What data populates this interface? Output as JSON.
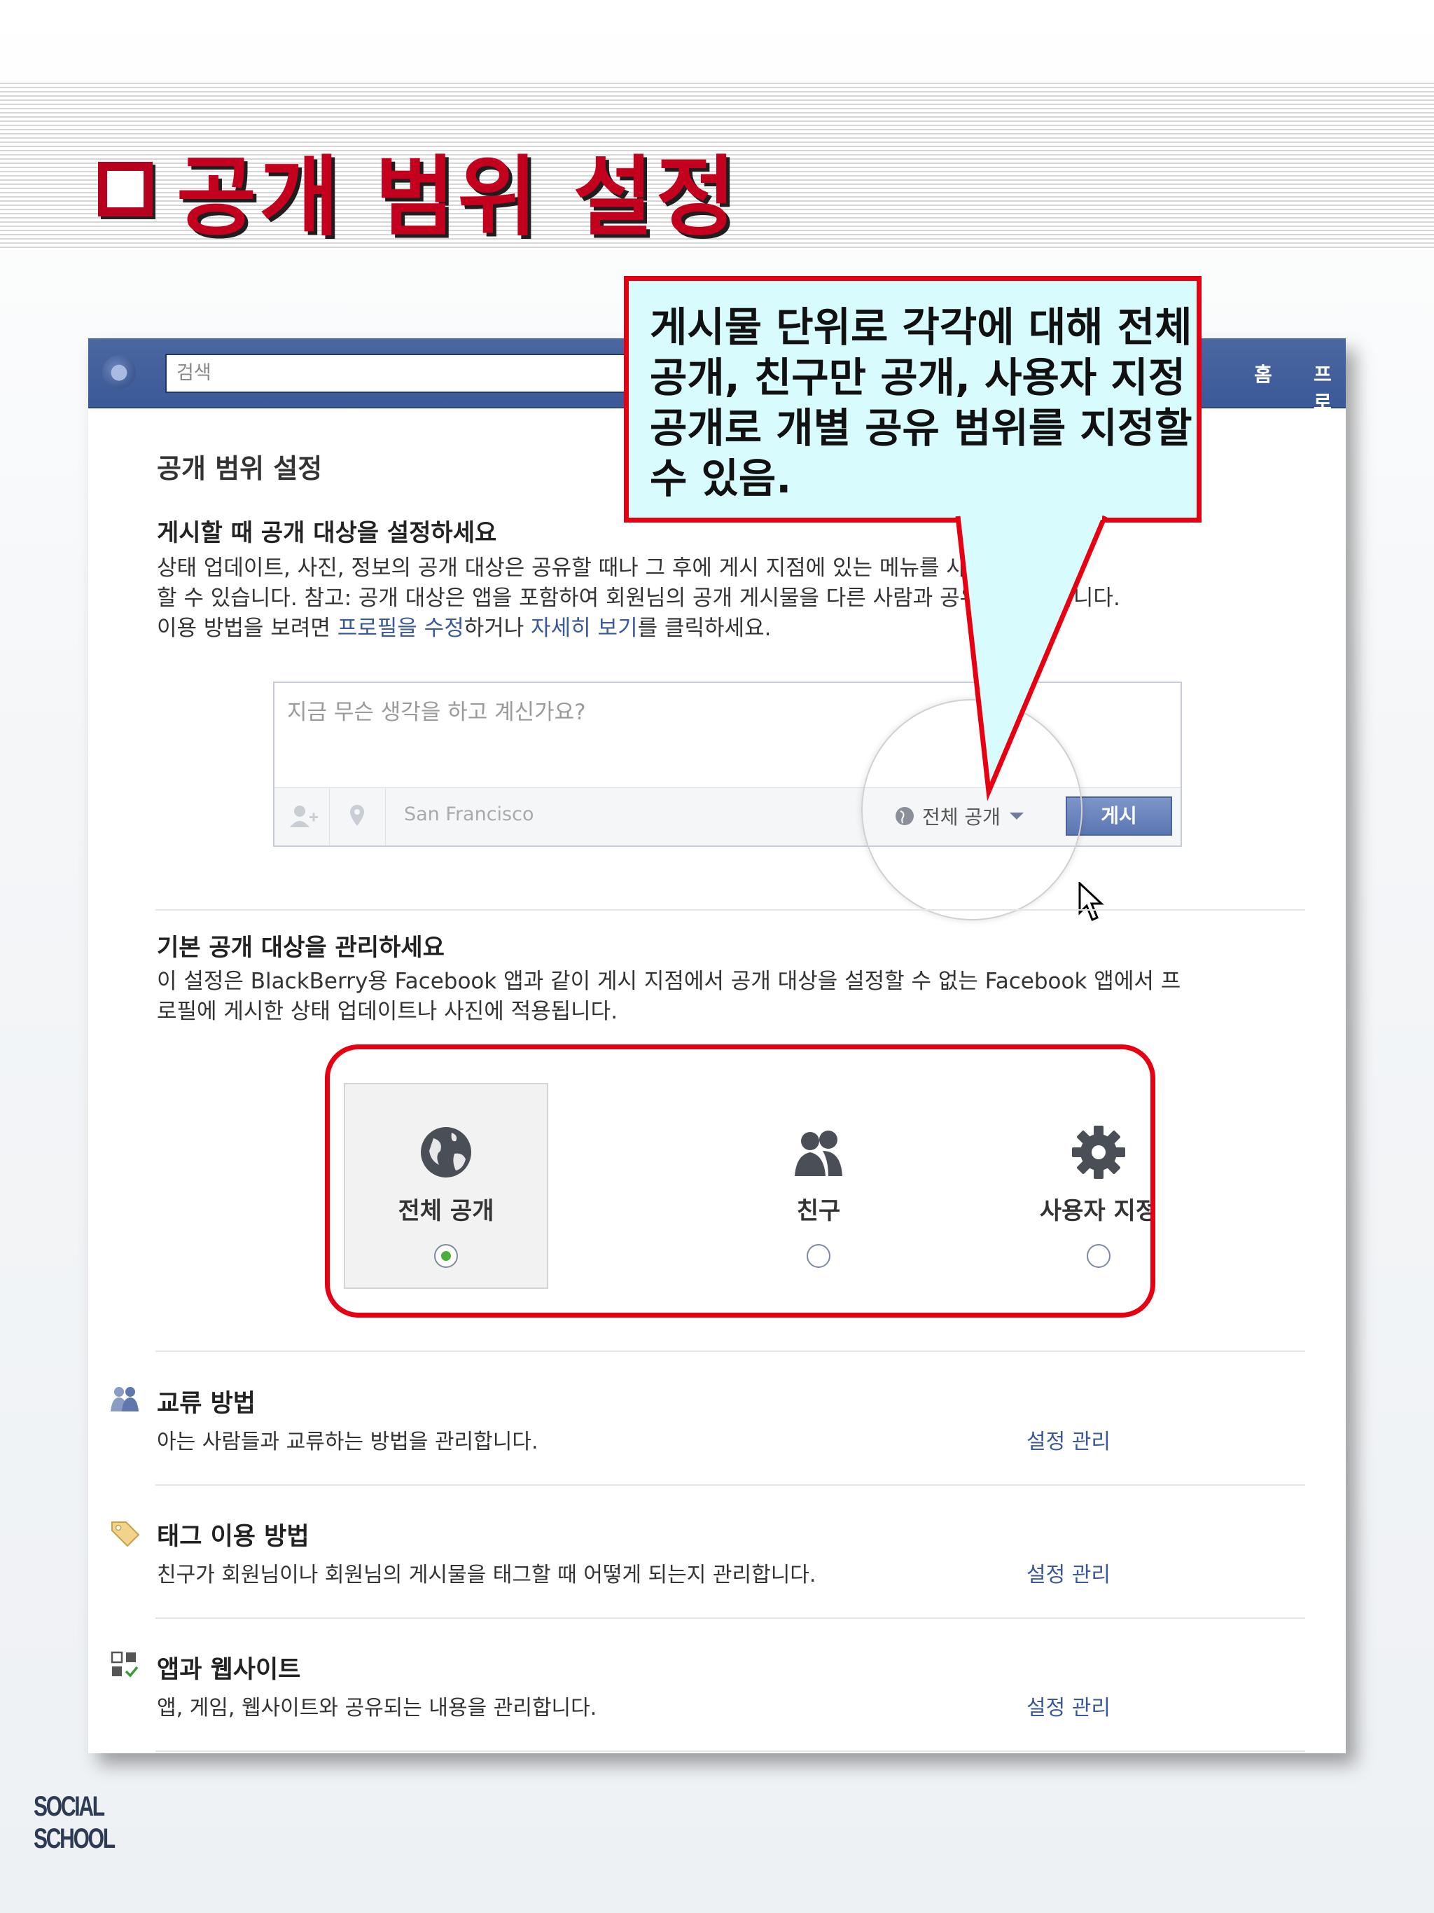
{
  "slide": {
    "title": "공개 범위 설정",
    "logo_text": "SOCIAL SCHOOL"
  },
  "callout": {
    "text": "게시물 단위로 각각에 대해 전체공개, 친구만 공개, 사용자 지정 공개로 개별 공유 범위를 지정할 수 있음."
  },
  "topbar": {
    "search_placeholder": "검색",
    "nav_home": "홈",
    "nav_profile": "프로"
  },
  "page": {
    "heading": "공개 범위 설정",
    "section1": {
      "title": "게시할 때 공개 대상을 설정하세요",
      "desc_line1": "상태 업데이트, 사진, 정보의 공개 대상은 공유할 때나 그 후에 게시 지점에 있는 메뉴를 사용하여 관리",
      "desc_line2": "할 수 있습니다. 참고: 공개 대상은 앱을 포함하여 회원님의 공개 게시물을 다른 사람과 공유할 수 있습니다.",
      "desc_line3_a": "이용 방법을 보려면 ",
      "desc_link1": "프로필을 수정",
      "desc_line3_b": "하거나 ",
      "desc_link2": "자세히 보기",
      "desc_line3_c": "를 클릭하세요."
    },
    "composer": {
      "placeholder": "지금 무슨 생각을 하고 계신가요?",
      "location": "San Francisco",
      "audience": "전체 공개",
      "post_button": "게시"
    },
    "section2": {
      "title": "기본 공개 대상을 관리하세요",
      "desc_line1": "이 설정은 BlackBerry용 Facebook 앱과 같이 게시 지점에서 공개 대상을 설정할 수 없는 Facebook 앱에서 프",
      "desc_line2": "로필에 게시한 상태 업데이트나 사진에 적용됩니다."
    },
    "privacy_options": [
      {
        "label": "전체 공개",
        "icon": "globe-icon",
        "selected": true
      },
      {
        "label": "친구",
        "icon": "friends-icon",
        "selected": false
      },
      {
        "label": "사용자 지정",
        "icon": "gear-icon",
        "selected": false
      }
    ],
    "settings": [
      {
        "title": "교류 방법",
        "desc": "아는 사람들과 교류하는 방법을 관리합니다.",
        "link": "설정 관리",
        "icon": "people-icon"
      },
      {
        "title": "태그 이용 방법",
        "desc": "친구가 회원님이나 회원님의 게시물을 태그할 때 어떻게 되는지 관리합니다.",
        "link": "설정 관리",
        "icon": "tag-icon"
      },
      {
        "title": "앱과 웹사이트",
        "desc": "앱, 게임, 웹사이트와 공유되는 내용을 관리합니다.",
        "link": "설정 관리",
        "icon": "apps-icon"
      }
    ]
  },
  "colors": {
    "facebook_blue": "#3b5998",
    "title_red": "#c4001f",
    "frame_red": "#e60012",
    "callout_bg": "#d8fbfe"
  }
}
